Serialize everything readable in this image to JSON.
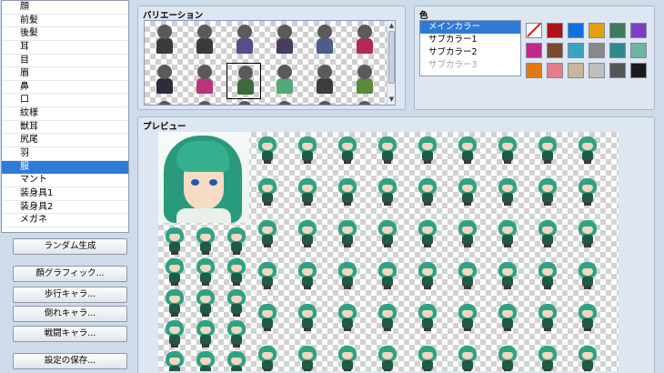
{
  "parts_list": {
    "items": [
      "顔",
      "前髪",
      "後髪",
      "耳",
      "目",
      "眉",
      "鼻",
      "口",
      "紋様",
      "獣耳",
      "尻尾",
      "羽",
      "服",
      "マント",
      "装身具1",
      "装身具2",
      "メガネ"
    ],
    "selected_index": 12
  },
  "buttons": {
    "random": "ランダム生成",
    "face_graphic": "顔グラフィック...",
    "walk_chara": "歩行キャラ...",
    "down_chara": "倒れキャラ...",
    "battle_chara": "戦闘キャラ...",
    "save_settings": "設定の保存..."
  },
  "variation": {
    "title": "バリエーション",
    "selected_cell": "row2-col3",
    "outfit_colors": [
      [
        "#3a3a3a",
        "#3a3a3a",
        "#5a4b8a",
        "#4a3c5c",
        "#4b5e8a",
        "#b02a55"
      ],
      [
        "#2c2c3a",
        "#b7357a",
        "#3a6b3f",
        "#55a877",
        "#3c3c3c",
        "#5a8a3b"
      ]
    ],
    "scroll_up_icon": "▲",
    "scroll_down_icon": "▼"
  },
  "color_panel": {
    "title": "色",
    "items": [
      "メインカラー",
      "サブカラー1",
      "サブカラー2",
      "サブカラー3"
    ],
    "selected_index": 0,
    "disabled_index": 3,
    "swatches": [
      [
        "none",
        "#b0101c",
        "#1470d8",
        "#e3a111",
        "#3f7a5c",
        "#7a3fc4"
      ],
      [
        "#c2288c",
        "#7a4a2a",
        "#3aa3c4",
        "#888888",
        "#2f8a8f",
        "#6bb5a0"
      ],
      [
        "#e07a10",
        "#e67d8a",
        "#c9b59a",
        "#bfbfbf",
        "#555555",
        "#1a1a1a"
      ]
    ]
  },
  "preview": {
    "title": "プレビュー",
    "hair_color": "#2ea383"
  }
}
